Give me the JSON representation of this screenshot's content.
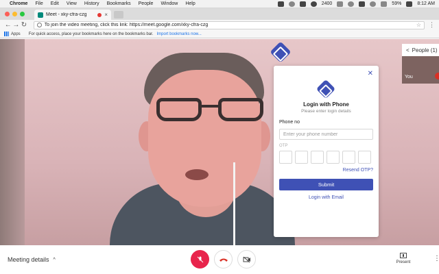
{
  "menubar": {
    "app": "Chrome",
    "items": [
      "File",
      "Edit",
      "View",
      "History",
      "Bookmarks",
      "People",
      "Window",
      "Help"
    ],
    "counter": "2400",
    "battery": "59%",
    "time": "8:12 AM"
  },
  "browser": {
    "tab_title": "Meet - xky-cfra-czg",
    "tab_close": "×",
    "url": "To join the video meeting, click this link: https://meet.google.com/xky-cfra-czg",
    "back": "←",
    "forward": "→",
    "reload": "↻",
    "star": "☆",
    "menu": "⋮"
  },
  "bookmarks": {
    "apps": "Apps",
    "hint": "For quick access, place your bookmarks here on the bookmarks bar.",
    "import": "Import bookmarks now..."
  },
  "people": {
    "label": "People (1)",
    "arrow": "<",
    "self": "You"
  },
  "login": {
    "close": "✕",
    "title": "Login with Phone",
    "subtitle": "Please enter login details",
    "phone_label": "Phone no",
    "phone_placeholder": "Enter your phone number",
    "otp_label": "OTP",
    "resend": "Resend OTP?",
    "submit": "Submit",
    "email_link": "Login with Email"
  },
  "bottom": {
    "meeting_details": "Meeting details",
    "chevron": "^",
    "present": "Present",
    "more": "⋮"
  },
  "colors": {
    "accent": "#3f51b5",
    "mic_off": "#e8244c",
    "hangup": "#d93025"
  }
}
